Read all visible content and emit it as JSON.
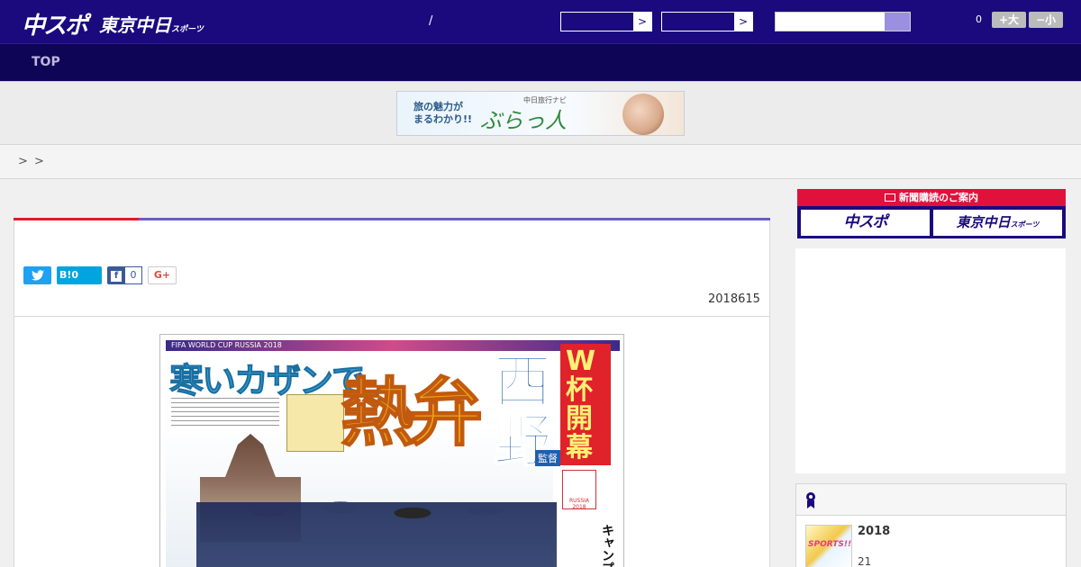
{
  "header": {
    "logo_chu": "中スポ",
    "logo_tokyo": "東京中日",
    "logo_tokyo_small": "スポーツ",
    "separator": "/",
    "dropdown_arrow": ">",
    "font_count": "0",
    "font_larger_label": "+大",
    "font_smaller_label": "−小"
  },
  "nav": {
    "top_label": "TOP"
  },
  "ad_banner": {
    "line1": "旅の魅力が\nまるわかり!!",
    "brand_small": "中日旅行ナビ",
    "brand": "ぶらっ人"
  },
  "breadcrumb": {
    "sep1": ">",
    "sep2": ">"
  },
  "article": {
    "date": "2018615",
    "share": {
      "hatena_label": "B!",
      "hatena_count": "0",
      "facebook_count": "0",
      "gplus_label": "G+"
    }
  },
  "paper": {
    "russia": "FIFA WORLD CUP RUSSIA 2018",
    "headline_cold": "寒いカザンで",
    "headline_hot": "熱弁",
    "headline_name": "西野",
    "headline_wcup": "W杯開幕",
    "kantoku": "監督",
    "camp": "キャンプ",
    "logo18": "RUSSIA 2018"
  },
  "sidebar": {
    "subscribe_title": "新聞購読のご案内",
    "subscribe_chu": "中スポ",
    "subscribe_tokyo": "東京中日",
    "subscribe_tokyo_small": "スポーツ",
    "ranking_item_title": "2018",
    "ranking_item_sub": "21",
    "ranking_thumb": "SPORTS!!"
  },
  "colors": {
    "header_bg": "#1a0a7e",
    "nav_bg": "#0f0556",
    "accent_red": "#e01b2a",
    "accent_purple": "#6a5acd"
  }
}
